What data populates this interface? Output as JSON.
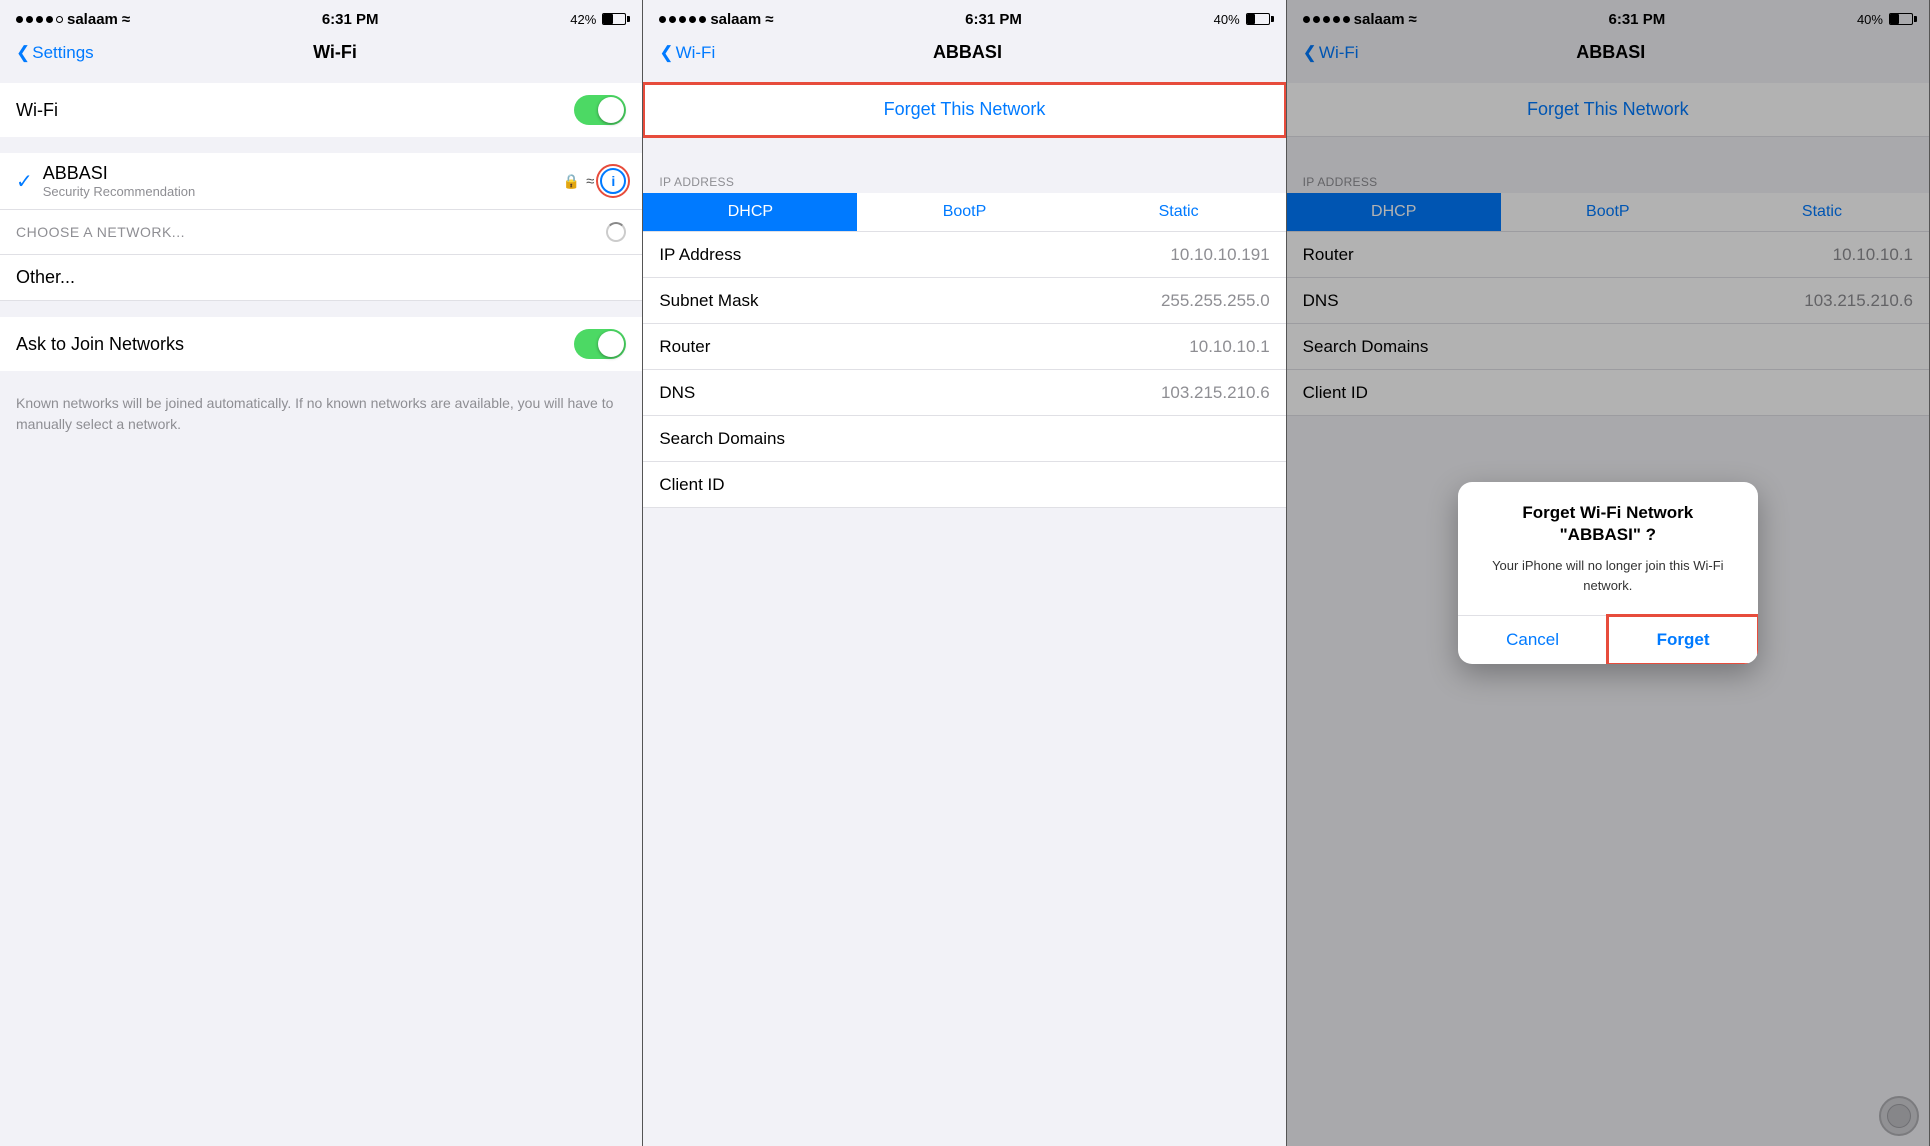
{
  "panel1": {
    "status": {
      "carrier": "salaam",
      "time": "6:31 PM",
      "battery": "42%",
      "battery_pct": 42
    },
    "nav": {
      "back_label": "Settings",
      "title": "Wi-Fi"
    },
    "wifi_toggle": {
      "label": "Wi-Fi",
      "state": "on"
    },
    "connected_network": {
      "name": "ABBASI",
      "sub": "Security Recommendation"
    },
    "choose_network": "CHOOSE A NETWORK...",
    "other": "Other...",
    "ask_to_join": {
      "label": "Ask to Join Networks",
      "state": "on",
      "description": "Known networks will be joined automatically. If no known networks are available, you will have to manually select a network."
    }
  },
  "panel2": {
    "status": {
      "carrier": "salaam",
      "time": "6:31 PM",
      "battery": "40%",
      "battery_pct": 40
    },
    "nav": {
      "back_label": "Wi-Fi",
      "title": "ABBASI"
    },
    "forget_network": "Forget This Network",
    "ip_address_header": "IP ADDRESS",
    "segments": [
      "DHCP",
      "BootP",
      "Static"
    ],
    "active_segment": 0,
    "rows": [
      {
        "label": "IP Address",
        "value": "10.10.10.191"
      },
      {
        "label": "Subnet Mask",
        "value": "255.255.255.0"
      },
      {
        "label": "Router",
        "value": "10.10.10.1"
      },
      {
        "label": "DNS",
        "value": "103.215.210.6"
      },
      {
        "label": "Search Domains",
        "value": ""
      },
      {
        "label": "Client ID",
        "value": ""
      }
    ]
  },
  "panel3": {
    "status": {
      "carrier": "salaam",
      "time": "6:31 PM",
      "battery": "40%",
      "battery_pct": 40
    },
    "nav": {
      "back_label": "Wi-Fi",
      "title": "ABBASI"
    },
    "forget_network": "Forget This Network",
    "ip_address_header": "IP ADDRESS",
    "segments": [
      "DHCP",
      "BootP",
      "Static"
    ],
    "active_segment": 0,
    "rows": [
      {
        "label": "Router",
        "value": "10.10.10.1"
      },
      {
        "label": "DNS",
        "value": "103.215.210.6"
      },
      {
        "label": "Search Domains",
        "value": ""
      },
      {
        "label": "Client ID",
        "value": ""
      }
    ],
    "dialog": {
      "title": "Forget Wi-Fi Network\n\"ABBASI\" ?",
      "message": "Your iPhone will no longer join this Wi-Fi network.",
      "cancel": "Cancel",
      "forget": "Forget"
    }
  },
  "icons": {
    "chevron": "❮",
    "check": "✓",
    "lock": "🔒",
    "wifi": "📶",
    "info": "i"
  }
}
